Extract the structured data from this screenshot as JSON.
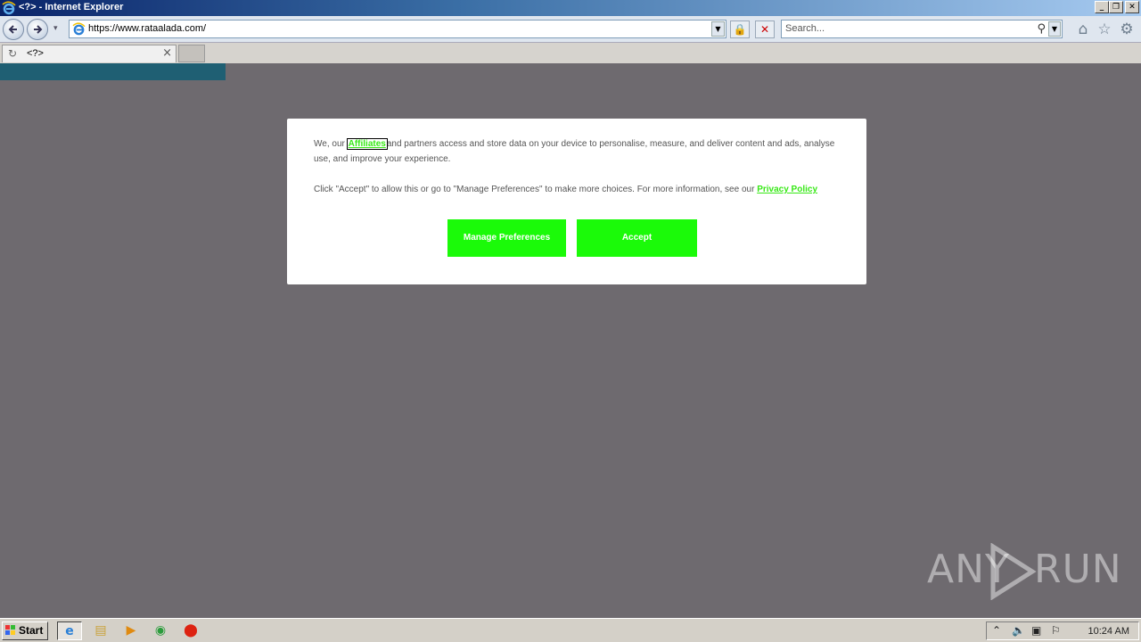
{
  "window": {
    "title": "<?> - Internet Explorer"
  },
  "navbar": {
    "url": "https://www.rataalada.com/",
    "search_placeholder": "Search...",
    "icons": [
      "back-icon",
      "forward-icon",
      "ie-logo-icon",
      "lock-icon",
      "stop-icon",
      "search-icon",
      "home-icon",
      "favorites-icon",
      "gear-icon"
    ]
  },
  "tab": {
    "title": "<?>"
  },
  "dialog": {
    "p1_before": "We, our ",
    "p1_link": "Affiliates",
    "p1_after": "and partners access and store data on your device to personalise, measure, and deliver content and ads, analyse use, and improve your experience.",
    "p2_before": "Click \"Accept\" to allow this or go to \"Manage Preferences\" to make more choices. For more information, see our ",
    "p2_link": "Privacy Policy",
    "manage_label": "Manage Preferences",
    "accept_label": "Accept",
    "accent_color": "#1bfa09"
  },
  "watermark": {
    "left": "ANY",
    "right": "RUN"
  },
  "taskbar": {
    "start_label": "Start",
    "clock": "10:24 AM"
  }
}
